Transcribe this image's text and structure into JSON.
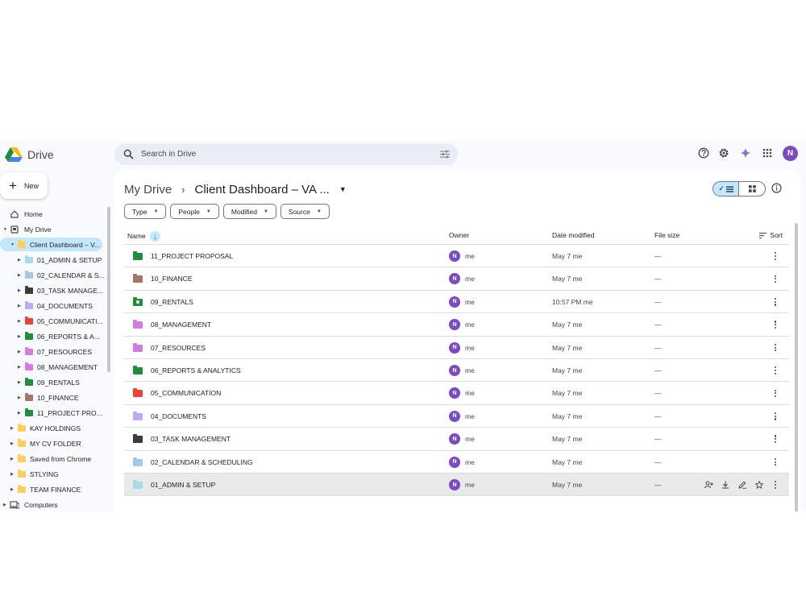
{
  "app": {
    "name": "Drive"
  },
  "search": {
    "placeholder": "Search in Drive"
  },
  "account": {
    "initial": "N",
    "color": "#7b4bc4"
  },
  "new_button": {
    "label": "New"
  },
  "sidebar": {
    "items": [
      {
        "label": "Home",
        "icon": "home-icon"
      },
      {
        "label": "My Drive",
        "icon": "my-drive-icon"
      },
      {
        "label": "Client Dashboard – V...",
        "color": "#ffcf5c",
        "selected": true
      },
      {
        "label": "01_ADMIN & SETUP",
        "color": "#a8dbe8"
      },
      {
        "label": "02_CALENDAR & S...",
        "color": "#a6c8e8"
      },
      {
        "label": "03_TASK MANAGE...",
        "color": "#3c3c3c"
      },
      {
        "label": "04_DOCUMENTS",
        "color": "#bfa8f5"
      },
      {
        "label": "05_COMMUNICATI...",
        "color": "#ea4335"
      },
      {
        "label": "06_REPORTS & A...",
        "color": "#1e8e3e"
      },
      {
        "label": "07_RESOURCES",
        "color": "#d47be3"
      },
      {
        "label": "08_MANAGEMENT",
        "color": "#d47be3"
      },
      {
        "label": "09_RENTALS",
        "color": "#1e8e3e"
      },
      {
        "label": "10_FINANCE",
        "color": "#a1776a"
      },
      {
        "label": "11_PROJECT PROP...",
        "color": "#1e8e3e"
      },
      {
        "label": "KAY HOLDINGS",
        "color": "#ffcf5c"
      },
      {
        "label": "MY CV FOLDER",
        "color": "#ffcf5c"
      },
      {
        "label": "Saved from Chrome",
        "color": "#ffcf5c"
      },
      {
        "label": "STLYING",
        "color": "#ffcf5c"
      },
      {
        "label": "TEAM FINANCE",
        "color": "#ffcf5c"
      },
      {
        "label": "Computers",
        "icon": "computers-icon"
      }
    ]
  },
  "breadcrumb": {
    "root": "My Drive",
    "separator": "›",
    "current": "Client Dashboard – VA ..."
  },
  "filters": [
    "Type",
    "People",
    "Modified",
    "Source"
  ],
  "table": {
    "columns": {
      "name": "Name",
      "owner": "Owner",
      "modified": "Date modified",
      "size": "File size",
      "sort": "Sort"
    },
    "rows": [
      {
        "name": "11_PROJECT PROPOSAL",
        "color": "#1e8e3e",
        "owner": "me",
        "owner_initial": "N",
        "modified": "May 7 me",
        "size": "—"
      },
      {
        "name": "10_FINANCE",
        "color": "#a1776a",
        "owner": "me",
        "owner_initial": "N",
        "modified": "May 7 me",
        "size": "—"
      },
      {
        "name": "09_RENTALS",
        "color": "#1e8e3e",
        "shared": true,
        "owner": "me",
        "owner_initial": "N",
        "modified": "10:57 PM me",
        "size": "—"
      },
      {
        "name": "08_MANAGEMENT",
        "color": "#d47be3",
        "owner": "me",
        "owner_initial": "N",
        "modified": "May 7 me",
        "size": "—"
      },
      {
        "name": "07_RESOURCES",
        "color": "#d47be3",
        "owner": "me",
        "owner_initial": "N",
        "modified": "May 7 me",
        "size": "—"
      },
      {
        "name": "06_REPORTS & ANALYTICS",
        "color": "#1e8e3e",
        "owner": "me",
        "owner_initial": "N",
        "modified": "May 7 me",
        "size": "—"
      },
      {
        "name": "05_COMMUNICATION",
        "color": "#ea4335",
        "owner": "me",
        "owner_initial": "N",
        "modified": "May 7 me",
        "size": "—"
      },
      {
        "name": "04_DOCUMENTS",
        "color": "#bfa8f5",
        "owner": "me",
        "owner_initial": "N",
        "modified": "May 7 me",
        "size": "—"
      },
      {
        "name": "03_TASK MANAGEMENT",
        "color": "#3c3c3c",
        "owner": "me",
        "owner_initial": "N",
        "modified": "May 7 me",
        "size": "—"
      },
      {
        "name": "02_CALENDAR & SCHEDULING",
        "color": "#a6c8e8",
        "owner": "me",
        "owner_initial": "N",
        "modified": "May 7 me",
        "size": "—"
      },
      {
        "name": "01_ADMIN & SETUP",
        "color": "#a8dbe8",
        "owner": "me",
        "owner_initial": "N",
        "modified": "May 7 me",
        "size": "—",
        "hovered": true
      }
    ]
  }
}
